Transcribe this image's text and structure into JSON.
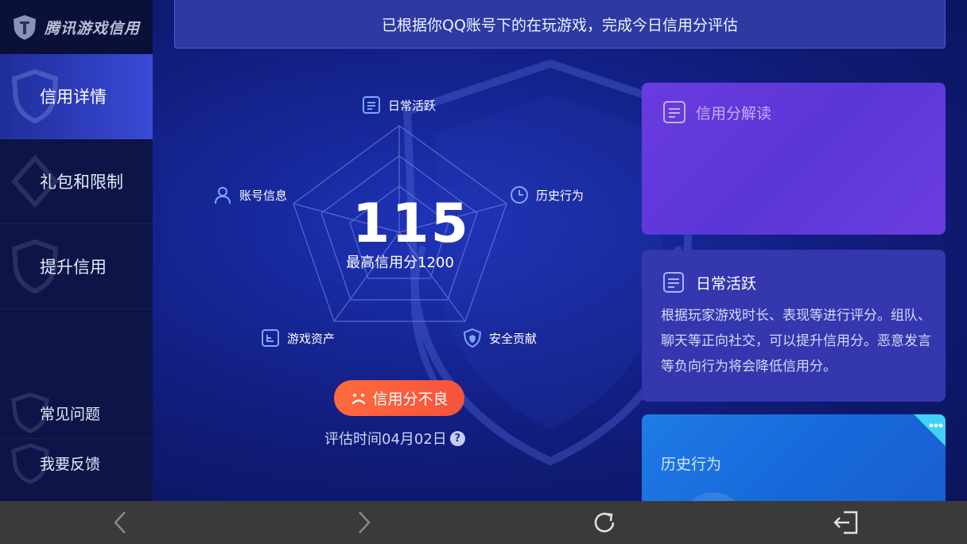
{
  "app": {
    "logo_text": "腾讯游戏信用"
  },
  "sidebar": {
    "items": [
      {
        "label": "信用详情",
        "active": true
      },
      {
        "label": "礼包和限制",
        "active": false
      },
      {
        "label": "提升信用",
        "active": false
      }
    ],
    "bottom_items": [
      {
        "label": "常见问题"
      },
      {
        "label": "我要反馈"
      }
    ]
  },
  "banner": {
    "text": "已根据你QQ账号下的在玩游戏，完成今日信用分评估"
  },
  "radar": {
    "axes": [
      {
        "label": "日常活跃",
        "icon": "document-icon"
      },
      {
        "label": "历史行为",
        "icon": "clock-icon"
      },
      {
        "label": "安全贡献",
        "icon": "shield-icon"
      },
      {
        "label": "游戏资产",
        "icon": "asset-icon"
      },
      {
        "label": "账号信息",
        "icon": "user-icon"
      }
    ]
  },
  "score": {
    "value": "115",
    "max_label": "最高信用分1200",
    "status": "信用分不良",
    "eval_time": "评估时间04月02日",
    "help": "?"
  },
  "cards": {
    "interpret": {
      "title": "信用分解读"
    },
    "daily": {
      "title": "日常活跃",
      "text": "根据玩家游戏时长、表现等进行评分。组队、聊天等正向社交，可以提升信用分。恶意发言等负向行为将会降低信用分。"
    },
    "history": {
      "title": "历史行为"
    }
  },
  "colors": {
    "accent": "#3a4ad6",
    "status_bad": "#f4533b",
    "card_purple": "#5b36d6",
    "card_indigo": "#3437ae",
    "card_blue": "#1667d8"
  }
}
